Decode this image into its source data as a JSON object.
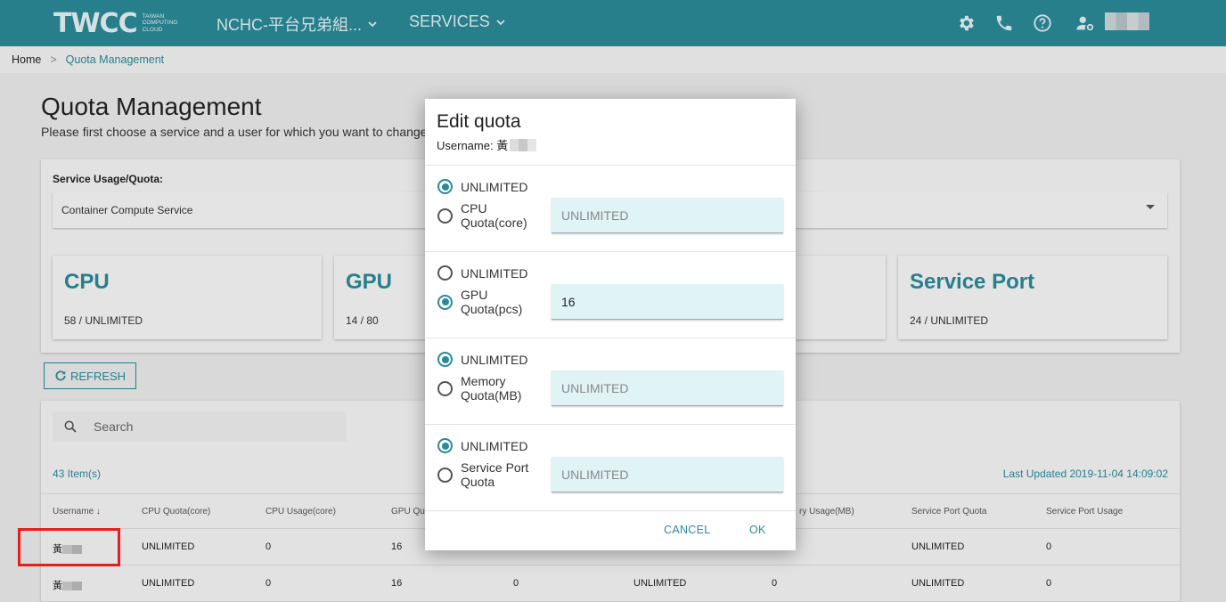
{
  "topbar": {
    "logo_text": "TWCC",
    "logo_sub": "TAIWAN COMPUTING CLOUD",
    "project": "NCHC-平台兄弟組...",
    "services": "SERVICES",
    "icons": [
      "gear-icon",
      "phone-icon",
      "help-icon",
      "user-settings-icon"
    ]
  },
  "breadcrumb": {
    "home": "Home",
    "separator": ">",
    "current": "Quota Management"
  },
  "page": {
    "title": "Quota Management",
    "description": "Please first choose a service and a user for which you want to change qu"
  },
  "service": {
    "label": "Service Usage/Quota:",
    "selected": "Container Compute Service"
  },
  "stats": [
    {
      "title": "CPU",
      "value": "58 / UNLIMITED"
    },
    {
      "title": "GPU",
      "value": "14 / 80"
    },
    {
      "title": "Service Port",
      "value": "24 / UNLIMITED"
    }
  ],
  "refresh_label": "REFRESH",
  "table": {
    "search_placeholder": "Search",
    "items_count": "43 Item(s)",
    "last_updated": "Last Updated 2019-11-04 14:09:02",
    "headers": [
      "Username",
      "CPU Quota(core)",
      "CPU Usage(core)",
      "GPU Qu",
      "ry Usage(MB)",
      "Service Port Quota",
      "Service Port Usage"
    ],
    "rows": [
      {
        "user": "黃",
        "cpu_quota": "UNLIMITED",
        "cpu_usage": "0",
        "gpu_quota": "16",
        "gpu_usage": "0",
        "mem_quota": "UNLIMITED",
        "mem_usage": "0",
        "sp_quota": "UNLIMITED",
        "sp_usage": "0"
      },
      {
        "user": "黃",
        "cpu_quota": "UNLIMITED",
        "cpu_usage": "0",
        "gpu_quota": "16",
        "gpu_usage": "0",
        "mem_quota": "UNLIMITED",
        "mem_usage": "0",
        "sp_quota": "UNLIMITED",
        "sp_usage": "0"
      }
    ]
  },
  "modal": {
    "title": "Edit quota",
    "username_label": "Username: 黃",
    "sections": [
      {
        "unlimited": "UNLIMITED",
        "quota_label": "CPU Quota(core)",
        "value": "UNLIMITED"
      },
      {
        "unlimited": "UNLIMITED",
        "quota_label": "GPU Quota(pcs)",
        "value": "16"
      },
      {
        "unlimited": "UNLIMITED",
        "quota_label": "Memory Quota(MB)",
        "value": "UNLIMITED"
      },
      {
        "unlimited": "UNLIMITED",
        "quota_label": "Service Port Quota",
        "value": "UNLIMITED"
      }
    ],
    "cancel": "CANCEL",
    "ok": "OK"
  },
  "colors": {
    "accent": "#2b8a98",
    "highlight": "#e81d1d"
  }
}
